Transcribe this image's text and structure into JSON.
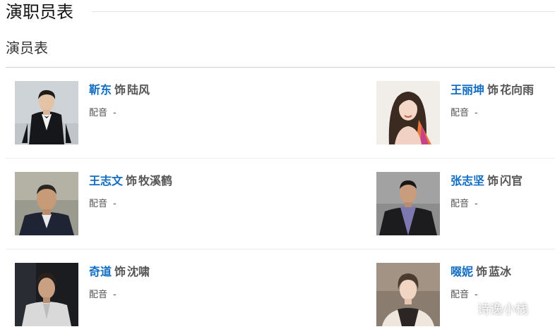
{
  "section": {
    "title": "演职员表"
  },
  "subsection": {
    "title": "演员表"
  },
  "cast": [
    {
      "actor": "靳东",
      "connector": "饰",
      "role": "陆风",
      "dub_label": "配音",
      "dub_value": "-"
    },
    {
      "actor": "王丽坤",
      "connector": "饰",
      "role": "花向雨",
      "dub_label": "配音",
      "dub_value": "-"
    },
    {
      "actor": "王志文",
      "connector": "饰",
      "role": "牧溪鹤",
      "dub_label": "配音",
      "dub_value": "-"
    },
    {
      "actor": "张志坚",
      "connector": "饰",
      "role": "闪官",
      "dub_label": "配音",
      "dub_value": "-"
    },
    {
      "actor": "奇道",
      "connector": "饰",
      "role": "沈啸",
      "dub_label": "配音",
      "dub_value": "-"
    },
    {
      "actor": "啜妮",
      "connector": "饰",
      "role": "蓝冰",
      "dub_label": "配音",
      "dub_value": "-"
    }
  ],
  "watermark": "诗逸小栈",
  "colors": {
    "actor_link": "#136ec2",
    "text": "#555555",
    "divider": "#ececec"
  }
}
